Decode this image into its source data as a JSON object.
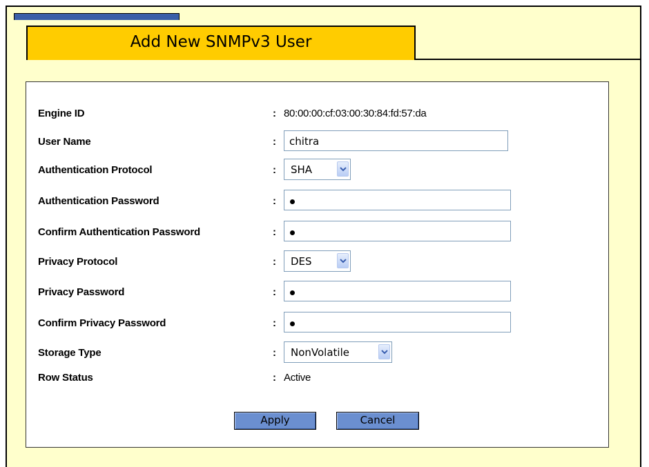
{
  "page": {
    "title": "Add New SNMPv3 User"
  },
  "form": {
    "engine_id": {
      "label": "Engine ID",
      "value": "80:00:00:cf:03:00:30:84:fd:57:da"
    },
    "user_name": {
      "label": "User Name",
      "value": "chitra"
    },
    "auth_protocol": {
      "label": "Authentication Protocol",
      "value": "SHA"
    },
    "auth_password": {
      "label": "Authentication Password"
    },
    "confirm_auth_password": {
      "label": "Confirm Authentication Password"
    },
    "privacy_protocol": {
      "label": "Privacy Protocol",
      "value": "DES"
    },
    "privacy_password": {
      "label": "Privacy Password"
    },
    "confirm_privacy_password": {
      "label": "Confirm Privacy Password"
    },
    "storage_type": {
      "label": "Storage Type",
      "value": "NonVolatile"
    },
    "row_status": {
      "label": "Row Status",
      "value": "Active"
    },
    "separator": ":"
  },
  "buttons": {
    "apply": "Apply",
    "cancel": "Cancel"
  },
  "colors": {
    "background": "#FFFFCC",
    "title_tab": "#FFCC00",
    "button": "#6b8fd0",
    "top_bar": "#3b5fa8"
  },
  "icons": {
    "dropdown": "chevron-down-icon"
  }
}
